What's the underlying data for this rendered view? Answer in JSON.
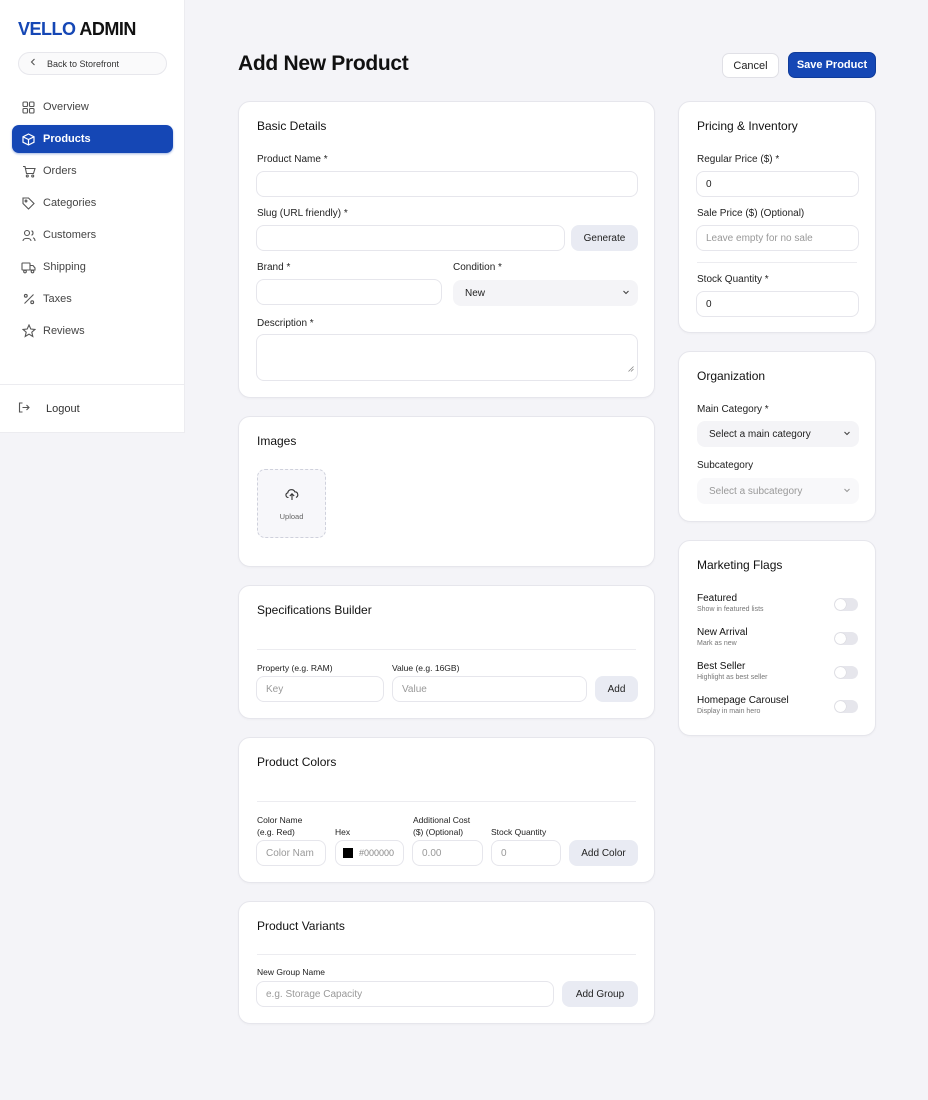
{
  "sidebar": {
    "brand_part1": "VELLO",
    "brand_part2": "ADMIN",
    "back_label": "Back to Storefront",
    "items": [
      {
        "label": "Overview",
        "icon": "grid-icon"
      },
      {
        "label": "Products",
        "icon": "box-icon",
        "active": true
      },
      {
        "label": "Orders",
        "icon": "cart-icon"
      },
      {
        "label": "Categories",
        "icon": "tag-icon"
      },
      {
        "label": "Customers",
        "icon": "users-icon"
      },
      {
        "label": "Shipping",
        "icon": "truck-icon"
      },
      {
        "label": "Taxes",
        "icon": "percent-icon"
      },
      {
        "label": "Reviews",
        "icon": "star-icon"
      }
    ],
    "logout_label": "Logout"
  },
  "header": {
    "title": "Add New Product",
    "cancel_label": "Cancel",
    "save_label": "Save Product"
  },
  "basic": {
    "title": "Basic Details",
    "name_label": "Product Name *",
    "name_value": "",
    "slug_label": "Slug (URL friendly) *",
    "slug_value": "",
    "generate_label": "Generate",
    "brand_label": "Brand *",
    "brand_value": "",
    "condition_label": "Condition *",
    "condition_value": "New",
    "description_label": "Description *"
  },
  "images": {
    "title": "Images",
    "upload_label": "Upload"
  },
  "specs": {
    "title": "Specifications Builder",
    "property_label": "Property (e.g. RAM)",
    "property_placeholder": "Key",
    "value_label": "Value (e.g. 16GB)",
    "value_placeholder": "Value",
    "add_label": "Add"
  },
  "colors": {
    "title": "Product Colors",
    "name_label_line1": "Color Name",
    "name_label_line2": "(e.g. Red)",
    "name_placeholder": "Color Nam",
    "hex_label": "Hex",
    "hex_value": "#000000",
    "swatch_color": "#000000",
    "cost_label_line1": "Additional Cost",
    "cost_label_line2": "($) (Optional)",
    "cost_placeholder": "0.00",
    "stock_label": "Stock Quantity",
    "stock_placeholder": "0",
    "add_label": "Add Color"
  },
  "variants": {
    "title": "Product Variants",
    "group_label": "New Group Name",
    "group_placeholder": "e.g. Storage Capacity",
    "add_label": "Add Group"
  },
  "pricing": {
    "title": "Pricing & Inventory",
    "regular_label": "Regular Price ($) *",
    "regular_value": "0",
    "sale_label": "Sale Price ($) (Optional)",
    "sale_placeholder": "Leave empty for no sale",
    "stock_label": "Stock Quantity *",
    "stock_value": "0"
  },
  "organization": {
    "title": "Organization",
    "main_label": "Main Category *",
    "main_value": "Select a main category",
    "sub_label": "Subcategory",
    "sub_value": "Select a subcategory"
  },
  "marketing": {
    "title": "Marketing Flags",
    "flags": [
      {
        "name": "Featured",
        "desc": "Show in featured lists",
        "on": false
      },
      {
        "name": "New Arrival",
        "desc": "Mark as new",
        "on": false
      },
      {
        "name": "Best Seller",
        "desc": "Highlight as best seller",
        "on": false
      },
      {
        "name": "Homepage Carousel",
        "desc": "Display in main hero",
        "on": false
      }
    ]
  },
  "colors_theme": {
    "accent": "#1547b5",
    "background": "#f4f4f8"
  }
}
